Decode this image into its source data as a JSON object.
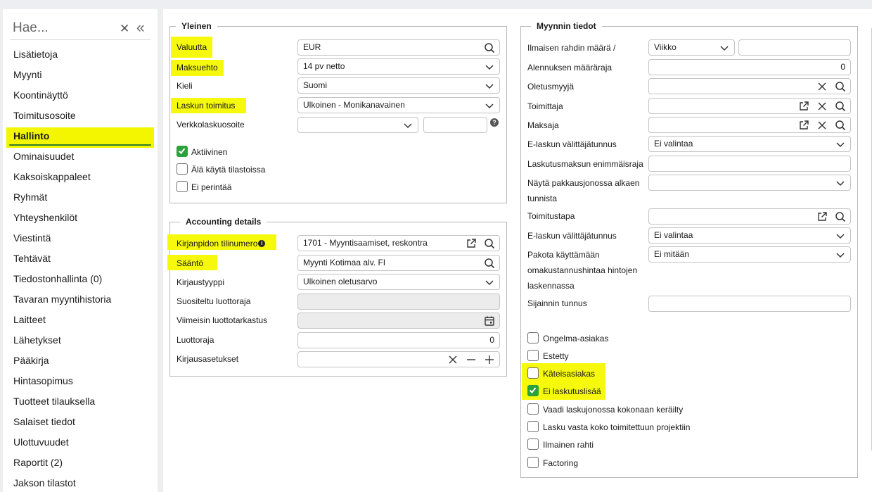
{
  "sidebar": {
    "search_placeholder": "Hae...",
    "items": [
      "Lisätietoja",
      "Myynti",
      "Koontinäyttö",
      "Toimitusosoite",
      "Hallinto",
      "Ominaisuudet",
      "Kaksoiskappaleet",
      "Ryhmät",
      "Yhteyshenkilöt",
      "Viestintä",
      "Tehtävät",
      "Tiedostonhallinta (0)",
      "Tavaran myyntihistoria",
      "Laitteet",
      "Lähetykset",
      "Pääkirja",
      "Hintasopimus",
      "Tuotteet tilauksella",
      "Salaiset tiedot",
      "Ulottuvuudet",
      "Raportit (2)",
      "Jakson tilastot"
    ],
    "active_index": 4
  },
  "general": {
    "legend": "Yleinen",
    "currency_label": "Valuutta",
    "currency_value": "EUR",
    "terms_label": "Maksuehto",
    "terms_value": "14 pv netto",
    "language_label": "Kieli",
    "language_value": "Suomi",
    "delivery_label": "Laskun toimitus",
    "delivery_value": "Ulkoinen - Monikanavainen",
    "einvoice_label": "Verkkolaskuosoite",
    "einvoice_value": "",
    "einvoice_extra": "",
    "active_label": "Aktiivinen",
    "active_checked": true,
    "nostats_label": "Älä käytä tilastoissa",
    "nostats_checked": false,
    "nocollect_label": "Ei perintää",
    "nocollect_checked": false
  },
  "accounting": {
    "legend": "Accounting details",
    "account_label": "Kirjanpidon tilinumero",
    "account_value": "1701 - Myyntisaamiset, reskontra",
    "rule_label": "Sääntö",
    "rule_value": "Myynti Kotimaa alv. FI",
    "posting_type_label": "Kirjaustyyppi",
    "posting_type_value": "Ulkoinen oletusarvo",
    "credit_sugg_label": "Suositeltu luottoraja",
    "credit_sugg_value": "",
    "credit_check_label": "Viimeisin luottotarkastus",
    "credit_check_value": "",
    "credit_limit_label": "Luottoraja",
    "credit_limit_value": "0",
    "posting_settings_label": "Kirjausasetukset",
    "posting_settings_value": ""
  },
  "sales": {
    "legend": "Myynnin tiedot",
    "freefreight_label": "Ilmaisen rahdin määrä /",
    "freefreight_period": "Viikko",
    "freefreight_value": "",
    "discount_label": "Alennuksen määräraja",
    "discount_value": "0",
    "seller_label": "Oletusmyyjä",
    "seller_value": "",
    "supplier_label": "Toimittaja",
    "supplier_value": "",
    "payer_label": "Maksaja",
    "payer_value": "",
    "einv_operator_label": "E-laskun välittäjätunnus",
    "einv_operator_value": "Ei valintaa",
    "billing_fee_label": "Laskutusmaksun enimmäisraja",
    "billing_fee_value": "",
    "package_queue_label_1": "Näytä pakkausjonossa alkaen",
    "package_queue_label_2": "tunnista",
    "package_queue_value": "",
    "delivery_method_label": "Toimitustapa",
    "delivery_method_value": "",
    "einv_operator2_label": "E-laskun välittäjätunnus",
    "einv_operator2_value": "Ei valintaa",
    "force_cost_label_1": "Pakota käyttämään",
    "force_cost_label_2": "omakustannushintaa hintojen",
    "force_cost_label_3": "laskennassa",
    "force_cost_value": "Ei mitään",
    "location_label": "Sijainnin tunnus",
    "location_value": "",
    "checkboxes": [
      {
        "label": "Ongelma-asiakas",
        "checked": false
      },
      {
        "label": "Estetty",
        "checked": false
      },
      {
        "label": "Käteisasiakas",
        "checked": false
      },
      {
        "label": "Ei laskutuslisää",
        "checked": true
      },
      {
        "label": "Vaadi laskujonossa kokonaan keräilty",
        "checked": false
      },
      {
        "label": "Lasku vasta koko toimitettuun projektiin",
        "checked": false
      },
      {
        "label": "Ilmainen rahti",
        "checked": false
      },
      {
        "label": "Factoring",
        "checked": false
      }
    ]
  },
  "colors": {
    "highlight": "#f6f90c",
    "check_green": "#2aa13b"
  }
}
